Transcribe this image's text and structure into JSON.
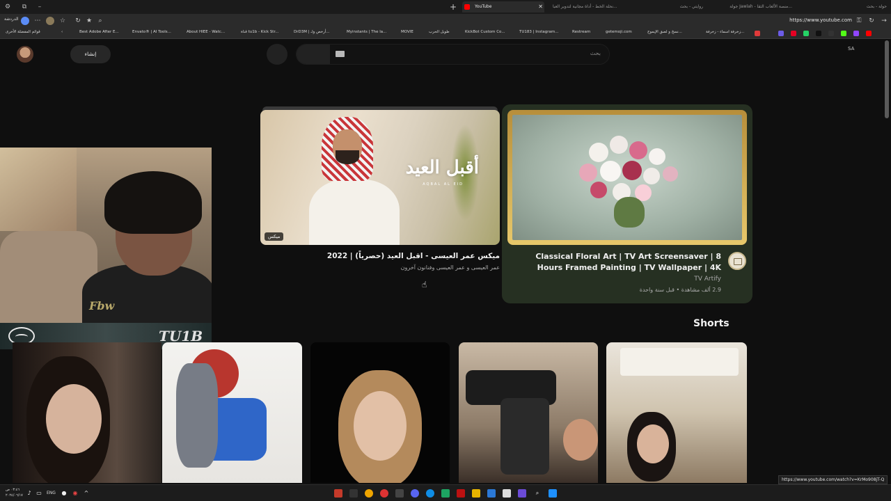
{
  "browser": {
    "tabs": [
      {
        "label": "حولة - بحث",
        "active": false
      },
      {
        "label": "جولة Jawlah - منصة الألعاب الثقا...",
        "active": false
      },
      {
        "label": "روايتي - بحث",
        "active": false
      },
      {
        "label": "نحلة الخط - أداة مجانية لتدوير العبا...",
        "active": false
      },
      {
        "label": "YouTube",
        "active": true
      }
    ],
    "url": "https://www.youtube.com",
    "profile_label": "الدردشة",
    "bookmarks": [
      "قوائم المفضلة الأخرى",
      "Best Adobe After E...",
      "Envato® | AI Tools...",
      "About HIEE - Watc...",
      "قناة tu1b - Kick Str...",
      "DrD3M | أرخص ولـ...",
      "Myinstants | The la...",
      "MOVIE",
      "طويل الحرب",
      "KickBot Custom Co...",
      "TU183 | Instagram...",
      "Restream",
      "getemoji.com",
      "نسخ و لصق الإيموج...",
      "زخرفة اسماء - زخرفة..."
    ]
  },
  "youtube": {
    "create_label": "إنشاء",
    "search_placeholder": "بحث",
    "country": "SA",
    "videos": [
      {
        "thumb_title": "أقبل العيد",
        "thumb_subtitle": "AQBAL AL EID",
        "badge": "ميكس",
        "title": "ميكس عمر العيسى - اقبل العيد (حصرياً) | 2022",
        "channel": "عمر العيسى و عمر العيسى وفنانون آخرون"
      },
      {
        "title": "Classical Floral Art | TV Art Screensaver | 8 Hours Framed Painting | TV Wallpaper | 4K",
        "channel": "TV Artify",
        "meta": "2.9 ألف مشاهدة • قبل سنة واحدة"
      }
    ],
    "shorts_title": "Shorts"
  },
  "overlay": {
    "shirt_text": "Fbw",
    "logo_text": "TU1B"
  },
  "status_url": "https://www.youtube.com/watch?v=KrMo908jT-Q",
  "taskbar": {
    "lang": "ENG",
    "time": "٠٣:٤٦ ص",
    "date": "٢٠٢٤/٠٦/١٧"
  },
  "colors": {
    "page_bg": "#0f0f0f",
    "card_highlight": "#263022",
    "accent_gold": "#c9a44a"
  }
}
